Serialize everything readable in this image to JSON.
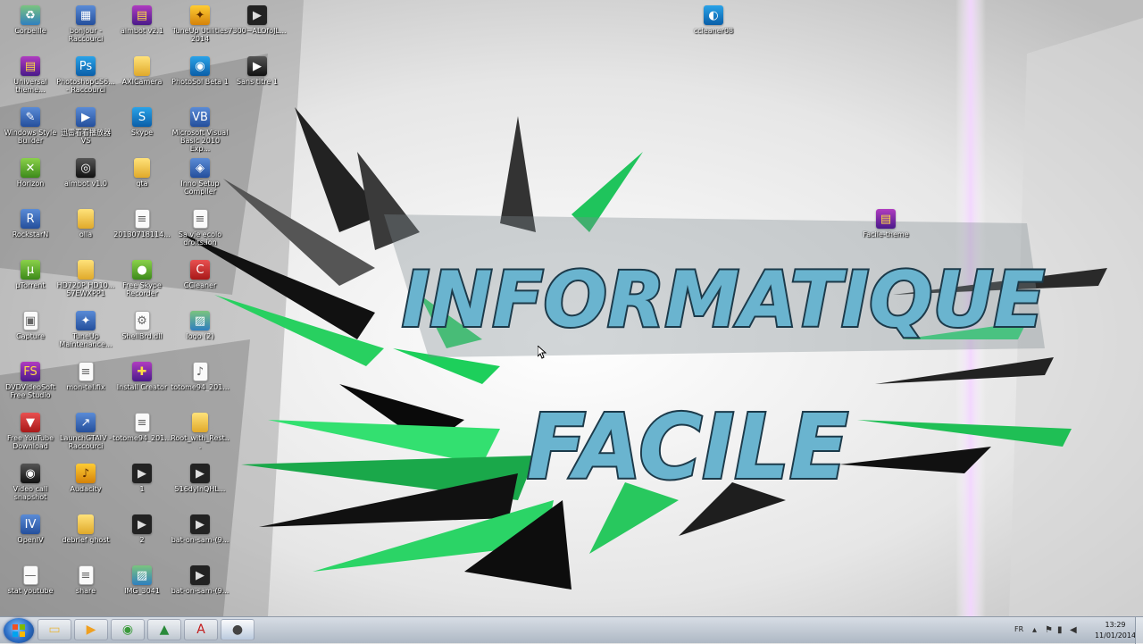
{
  "wallpaper": {
    "line1": "INFORMATIQUE",
    "line2": "FACILE"
  },
  "icons": [
    {
      "label": "Corbeille",
      "icon": "recycle-bin-icon",
      "glyph": "♻",
      "kind": "g-image"
    },
    {
      "label": "Universal theme...",
      "icon": "winrar-archive-icon",
      "glyph": "▤",
      "kind": "g-archive"
    },
    {
      "label": "Windows Style Builder",
      "icon": "style-builder-icon",
      "glyph": "✎",
      "kind": "g-app"
    },
    {
      "label": "Horizon",
      "icon": "xbox-icon",
      "glyph": "✕",
      "kind": "g-green"
    },
    {
      "label": "RockstarN",
      "icon": "app-shortcut-icon",
      "glyph": "R",
      "kind": "g-app"
    },
    {
      "label": "µTorrent",
      "icon": "utorrent-icon",
      "glyph": "µ",
      "kind": "g-green"
    },
    {
      "label": "Capture",
      "icon": "capture-icon",
      "glyph": "▣",
      "kind": "g-file"
    },
    {
      "label": "DVDVideoSoft Free Studio",
      "icon": "dvdvideosoft-icon",
      "glyph": "FS",
      "kind": "g-archive"
    },
    {
      "label": "Free YouTube Download",
      "icon": "youtube-download-icon",
      "glyph": "▼",
      "kind": "g-red"
    },
    {
      "label": "Video call snapshot",
      "icon": "snapshot-icon",
      "glyph": "◉",
      "kind": "g-dark"
    },
    {
      "label": "OpenIV",
      "icon": "openiv-icon",
      "glyph": "IV",
      "kind": "g-app"
    },
    {
      "label": "stat youtube",
      "icon": "shortcut-icon",
      "glyph": "—",
      "kind": "g-file"
    },
    {
      "label": "bonjour - Raccourci",
      "icon": "shortcut-icon",
      "glyph": "▦",
      "kind": "g-app"
    },
    {
      "label": "PhotoshopCS6... - Raccourci",
      "icon": "photoshop-icon",
      "glyph": "Ps",
      "kind": "g-blue"
    },
    {
      "label": "迅雷看看播放器 VS",
      "icon": "media-player-icon",
      "glyph": "▶",
      "kind": "g-app"
    },
    {
      "label": "aimbot v1.0",
      "icon": "app-icon",
      "glyph": "◎",
      "kind": "g-dark"
    },
    {
      "label": "olla",
      "icon": "folder-icon",
      "glyph": "",
      "kind": "g-folder"
    },
    {
      "label": "HD720P HD10... 57EWXPP1",
      "icon": "folder-icon",
      "glyph": "",
      "kind": "g-folder"
    },
    {
      "label": "TuneUp Maintenance...",
      "icon": "tuneup-icon",
      "glyph": "✦",
      "kind": "g-app"
    },
    {
      "label": "mon-tel.fix",
      "icon": "file-icon",
      "glyph": "≡",
      "kind": "g-file"
    },
    {
      "label": "LaunchGTAIV - Raccourci",
      "icon": "shortcut-icon",
      "glyph": "↗",
      "kind": "g-app"
    },
    {
      "label": "Audacity",
      "icon": "audacity-icon",
      "glyph": "♪",
      "kind": "g-gold"
    },
    {
      "label": "debrief ghost",
      "icon": "folder-icon",
      "glyph": "",
      "kind": "g-folder"
    },
    {
      "label": "share",
      "icon": "file-icon",
      "glyph": "≡",
      "kind": "g-file"
    },
    {
      "label": "aimbot v2.1",
      "icon": "winrar-archive-icon",
      "glyph": "▤",
      "kind": "g-archive"
    },
    {
      "label": "AXICamera",
      "icon": "folder-icon",
      "glyph": "",
      "kind": "g-folder"
    },
    {
      "label": "Skype",
      "icon": "skype-icon",
      "glyph": "S",
      "kind": "g-blue"
    },
    {
      "label": "gta",
      "icon": "folder-icon",
      "glyph": "",
      "kind": "g-folder"
    },
    {
      "label": "20130718114...",
      "icon": "file-icon",
      "glyph": "≡",
      "kind": "g-file"
    },
    {
      "label": "Free Skype Recorder",
      "icon": "skype-recorder-icon",
      "glyph": "●",
      "kind": "g-green"
    },
    {
      "label": "ShellBrd.dll",
      "icon": "dll-file-icon",
      "glyph": "⚙",
      "kind": "g-file"
    },
    {
      "label": "Install Creator",
      "icon": "install-creator-icon",
      "glyph": "✚",
      "kind": "g-archive"
    },
    {
      "label": "totome94_201...",
      "icon": "file-icon",
      "glyph": "≡",
      "kind": "g-file"
    },
    {
      "label": "1",
      "icon": "video-file-icon",
      "glyph": "▶",
      "kind": "g-video"
    },
    {
      "label": "2",
      "icon": "video-file-icon",
      "glyph": "▶",
      "kind": "g-video"
    },
    {
      "label": "IMG_3041",
      "icon": "image-file-icon",
      "glyph": "▨",
      "kind": "g-image"
    },
    {
      "label": "TuneUp Utilities 2014",
      "icon": "tuneup-icon",
      "glyph": "✦",
      "kind": "g-gold"
    },
    {
      "label": "PhotoSol Beta 1",
      "icon": "app-icon",
      "glyph": "◉",
      "kind": "g-blue"
    },
    {
      "label": "Microsoft Visual Basic 2010 Exp...",
      "icon": "visual-basic-icon",
      "glyph": "VB",
      "kind": "g-app"
    },
    {
      "label": "Inno Setup Compiler",
      "icon": "inno-setup-icon",
      "glyph": "◈",
      "kind": "g-app"
    },
    {
      "label": "Sa vie ecolo droits.ion",
      "icon": "file-icon",
      "glyph": "≡",
      "kind": "g-file"
    },
    {
      "label": "CCleaner",
      "icon": "ccleaner-icon",
      "glyph": "C",
      "kind": "g-red"
    },
    {
      "label": "logo (2)",
      "icon": "image-file-icon",
      "glyph": "▨",
      "kind": "g-image"
    },
    {
      "label": "totome94_201...",
      "icon": "audio-file-icon",
      "glyph": "♪",
      "kind": "g-file"
    },
    {
      "label": "Root_with_Rest...",
      "icon": "folder-icon",
      "glyph": "",
      "kind": "g-folder"
    },
    {
      "label": "516dyInQHL...",
      "icon": "video-file-icon",
      "glyph": "▶",
      "kind": "g-video"
    },
    {
      "label": "bat-on-sam-(9...",
      "icon": "video-file-icon",
      "glyph": "▶",
      "kind": "g-video"
    },
    {
      "label": "bat-on-sam-(9...",
      "icon": "video-file-icon",
      "glyph": "▶",
      "kind": "g-video"
    },
    {
      "label": "7300~ALOfoJL...",
      "icon": "video-file-icon",
      "glyph": "▶",
      "kind": "g-video"
    },
    {
      "label": "Sans titre 1",
      "icon": "video-file-icon",
      "glyph": "▶",
      "kind": "g-dark"
    },
    {
      "label": "ccleaner08",
      "icon": "setup-icon",
      "glyph": "◐",
      "kind": "g-blue"
    },
    {
      "label": "Facile-theme",
      "icon": "winrar-archive-icon",
      "glyph": "▤",
      "kind": "g-archive"
    }
  ],
  "taskbar": {
    "pinned": [
      {
        "name": "explorer",
        "icon": "folder-icon",
        "glyph": "▭"
      },
      {
        "name": "media-player",
        "icon": "media-player-icon",
        "glyph": "▶"
      },
      {
        "name": "chrome",
        "icon": "chrome-icon",
        "glyph": "◉"
      },
      {
        "name": "camtasia",
        "icon": "camtasia-icon",
        "glyph": "▲"
      },
      {
        "name": "acrobat",
        "icon": "acrobat-icon",
        "glyph": "A"
      },
      {
        "name": "recorder",
        "icon": "recorder-icon",
        "glyph": "●"
      }
    ],
    "language": "FR",
    "time": "13:29",
    "date": "11/01/2014"
  }
}
